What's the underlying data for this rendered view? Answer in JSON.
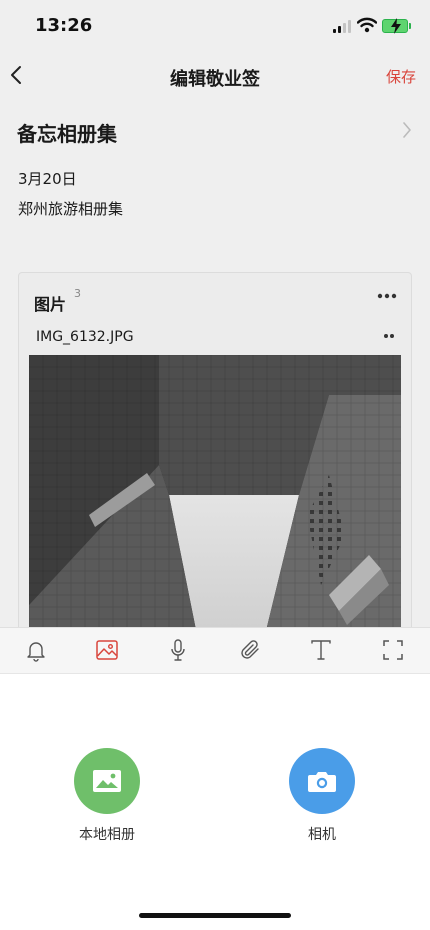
{
  "status_bar": {
    "time": "13:26"
  },
  "nav": {
    "title": "编辑敬业签",
    "save_label": "保存"
  },
  "notebook": {
    "name": "备忘相册集"
  },
  "note": {
    "date": "3月20日",
    "text": "郑州旅游相册集"
  },
  "attachment_card": {
    "title": "图片",
    "count": "3",
    "file_name": "IMG_6132.JPG"
  },
  "toolbar": {
    "tools": [
      "bell-icon",
      "image-icon",
      "microphone-icon",
      "paperclip-icon",
      "text-icon",
      "fullscreen-icon"
    ],
    "active_color": "#d9453c"
  },
  "actions": {
    "local_album": {
      "label": "本地相册",
      "color": "#6fbf6a"
    },
    "camera": {
      "label": "相机",
      "color": "#4a9de8"
    }
  }
}
